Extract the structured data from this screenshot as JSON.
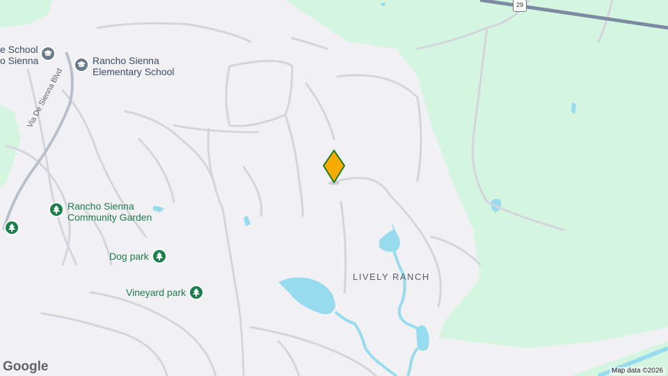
{
  "map": {
    "colors": {
      "land": "#f1f1f4",
      "park": "#d4f5e0",
      "water": "#97dcee",
      "road": "#ffffff",
      "road_outline": "#d4d5dc",
      "highway": "#7d8aa3",
      "marker": "#f9ab00",
      "marker_outline": "#1e7a1e"
    },
    "labels": {
      "school_partial": "e School\no Sienna",
      "elementary_school": "Rancho Sienna\nElementary School",
      "community_garden": "Rancho Sienna\nCommunity Garden",
      "dog_park": "Dog park",
      "vineyard_park": "Vineyard park",
      "lively_ranch": "LIVELY RANCH",
      "via_de_sienna": "Via De Sienna Blvd",
      "highway_shield": "29"
    },
    "icons": [
      "school-icon",
      "park-icon",
      "tree-icon",
      "location-marker-icon"
    ],
    "attribution": "Map data ©2026",
    "logo": "Google"
  }
}
